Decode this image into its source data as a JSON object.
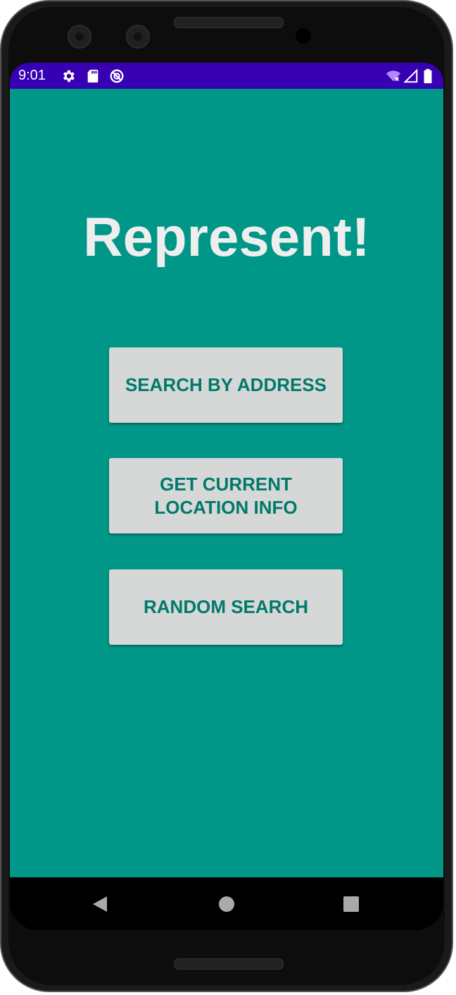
{
  "status_bar": {
    "time": "9:01",
    "left_icons": [
      "gear-icon",
      "sd-card-icon",
      "do-not-disturb-icon"
    ],
    "right_icons": [
      "wifi-icon",
      "signal-icon",
      "battery-icon"
    ],
    "color": "#3700b3"
  },
  "app": {
    "title": "Represent!",
    "background_color": "#009688",
    "buttons": [
      {
        "label": "SEARCH BY ADDRESS"
      },
      {
        "label": "GET CURRENT\nLOCATION INFO"
      },
      {
        "label": "RANDOM SEARCH"
      }
    ],
    "button_text_color": "#00796b",
    "button_bg_color": "#d6d8d8"
  },
  "nav_bar": {
    "icons": [
      "back-icon",
      "home-icon",
      "recents-icon"
    ]
  }
}
